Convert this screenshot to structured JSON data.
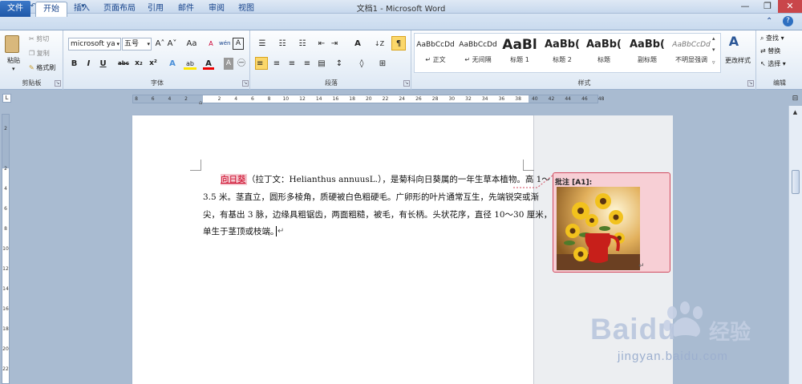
{
  "window": {
    "title": "文档1 - Microsoft Word",
    "minimize": "—",
    "restore": "❐",
    "close": "✕"
  },
  "qat": {
    "word_icon": "W",
    "save": "▪",
    "undo": "↶",
    "redo": "↻",
    "bullets": "☰",
    "more": "▾"
  },
  "tabs": [
    "文件",
    "开始",
    "插入",
    "页面布局",
    "引用",
    "邮件",
    "审阅",
    "视图"
  ],
  "ribbon": {
    "clipboard": {
      "paste": "粘贴",
      "cut": "剪切",
      "copy": "复制",
      "format_painter": "格式刷",
      "label": "剪贴板"
    },
    "font": {
      "font_name": "microsoft ya",
      "font_size": "五号",
      "grow": "A˄",
      "shrink": "A˅",
      "change_case": "Aa",
      "clear_fmt": "A",
      "phonetic": "wén",
      "enclose": "字",
      "border_char": "A",
      "bold": "B",
      "italic": "I",
      "underline": "U",
      "strike": "abc",
      "subscript": "x₂",
      "superscript": "x²",
      "text_effect": "A",
      "highlight": "ab",
      "font_color": "A",
      "char_shade": "A",
      "enclose2": "㊀",
      "label": "字体"
    },
    "paragraph": {
      "bullets": "☰",
      "numbering": "☷",
      "multilevel": "☷",
      "dec_indent": "⇤",
      "inc_indent": "⇥",
      "chinese_layout": "A",
      "sort": "↓Z",
      "show_marks": "¶",
      "align_left": "≡",
      "center": "≡",
      "align_right": "≡",
      "justify": "≡",
      "distributed": "▤",
      "line_spacing": "↕",
      "shading": "◊",
      "borders": "⊞",
      "label": "段落"
    },
    "styles": {
      "items": [
        {
          "sample": "AaBbCcDd",
          "name": "↵ 正文"
        },
        {
          "sample": "AaBbCcDd",
          "name": "↵ 无间隔"
        },
        {
          "sample": "AaBl",
          "name": "标题 1"
        },
        {
          "sample": "AaBb(",
          "name": "标题 2"
        },
        {
          "sample": "AaBb(",
          "name": "标题"
        },
        {
          "sample": "AaBb(",
          "name": "副标题"
        },
        {
          "sample": "AaBbCcDd",
          "name": "不明显强调"
        }
      ],
      "change_styles": "更改样式",
      "label": "样式"
    },
    "editing": {
      "find": "查找 ▾",
      "replace": "替换",
      "select": "选择 ▾",
      "label": "编辑"
    }
  },
  "ruler": {
    "h_ticks": [
      "8",
      "6",
      "4",
      "2",
      "",
      "2",
      "4",
      "6",
      "8",
      "10",
      "12",
      "14",
      "16",
      "18",
      "20",
      "22",
      "24",
      "26",
      "28",
      "30",
      "32",
      "34",
      "36",
      "38",
      "40",
      "42",
      "44",
      "46",
      "48"
    ],
    "v_ticks": [
      "2",
      "",
      "2",
      "4",
      "6",
      "8",
      "10",
      "12",
      "14",
      "16",
      "18",
      "20",
      "22"
    ]
  },
  "document": {
    "line1_keyword": "向日葵",
    "line1_rest": "（拉丁文：Helianthus annuusL.），是菊科向日葵属的一年生草本植物。高 1～",
    "line2": "3.5 米。茎直立，圆形多棱角，质硬被白色粗硬毛。广卵形的叶片通常互生，先端锐突或渐",
    "line3": "尖，有基出 3 脉，边缘具粗锯齿，两面粗糙，被毛，有长柄。头状花序，直径 10～30 厘米，",
    "line4": "单生于茎顶或枝端。",
    "cursor_mark": "↵"
  },
  "comment": {
    "title": "批注 [A1]:",
    "picture": "sunflowers-in-red-vase-photo",
    "end_mark": "↵"
  },
  "watermark": {
    "brand": "Baidu",
    "brand_cn": "经验",
    "url": "jingyan.baidu.com"
  },
  "colors": {
    "accent": "#1f58a8",
    "comment_fill": "#f7cfd5",
    "comment_border": "#d14b5f",
    "highlight": "#f4c7cf"
  }
}
